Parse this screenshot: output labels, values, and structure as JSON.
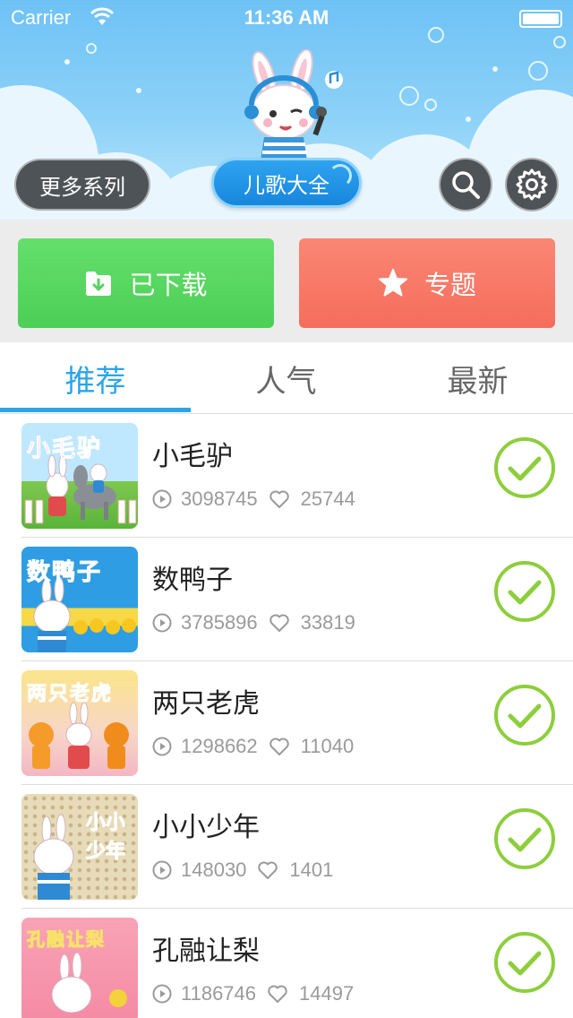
{
  "status_bar": {
    "carrier": "Carrier",
    "time": "11:36 AM"
  },
  "header": {
    "more_series_label": "更多系列",
    "songs_label": "儿歌大全"
  },
  "actions": {
    "downloaded_label": "已下载",
    "topics_label": "专题"
  },
  "tabs": [
    {
      "label": "推荐",
      "active": true
    },
    {
      "label": "人气",
      "active": false
    },
    {
      "label": "最新",
      "active": false
    }
  ],
  "songs": [
    {
      "title": "小毛驴",
      "thumb_text": "小毛驴",
      "plays": "3098745",
      "likes": "25744",
      "downloaded": true
    },
    {
      "title": "数鸭子",
      "thumb_text": "数鸭子",
      "plays": "3785896",
      "likes": "33819",
      "downloaded": true
    },
    {
      "title": "两只老虎",
      "thumb_text": "两只老虎",
      "plays": "1298662",
      "likes": "11040",
      "downloaded": true
    },
    {
      "title": "小小少年",
      "thumb_text": "小小少年",
      "plays": "148030",
      "likes": "1401",
      "downloaded": true
    },
    {
      "title": "孔融让梨",
      "thumb_text": "孔融让梨",
      "plays": "1186746",
      "likes": "14497",
      "downloaded": true
    }
  ],
  "colors": {
    "accent_blue": "#2ba4e8",
    "download_green": "#5ad862",
    "topic_red": "#f77a69",
    "check_green": "#8dce3c"
  }
}
